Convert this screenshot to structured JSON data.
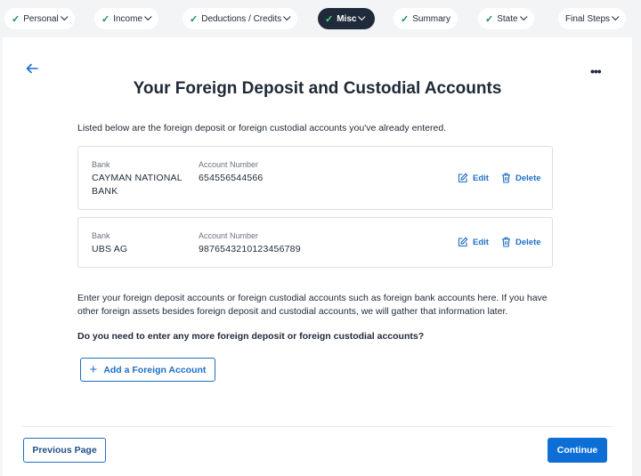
{
  "nav": {
    "tabs": [
      {
        "label": "Personal",
        "completed": true,
        "active": false
      },
      {
        "label": "Income",
        "completed": true,
        "active": false
      },
      {
        "label": "Deductions / Credits",
        "completed": true,
        "active": false
      },
      {
        "label": "Misc",
        "completed": true,
        "active": true
      },
      {
        "label": "Summary",
        "completed": true,
        "active": false
      },
      {
        "label": "State",
        "completed": true,
        "active": false
      },
      {
        "label": "Final Steps",
        "completed": false,
        "active": false
      }
    ]
  },
  "page": {
    "title": "Your Foreign Deposit and Custodial Accounts",
    "intro": "Listed below are the foreign deposit or foreign custodial accounts you've already entered.",
    "paragraph": "Enter your foreign deposit accounts or foreign custodial accounts such as foreign bank accounts here. If you have other foreign assets besides foreign deposit and custodial accounts, we will gather that information later.",
    "question": "Do you need to enter any more foreign deposit or foreign custodial accounts?"
  },
  "accounts": [
    {
      "bank_label": "Bank",
      "bank": "CAYMAN NATIONAL BANK",
      "number_label": "Account Number",
      "number": "654556544566",
      "edit_label": "Edit",
      "delete_label": "Delete"
    },
    {
      "bank_label": "Bank",
      "bank": "UBS AG",
      "number_label": "Account Number",
      "number": "9876543210123456789",
      "edit_label": "Edit",
      "delete_label": "Delete"
    }
  ],
  "buttons": {
    "add_account": "Add a Foreign Account",
    "previous": "Previous Page",
    "continue": "Continue"
  },
  "icons": {
    "back": "back-arrow-icon",
    "more": "more-options-icon",
    "check": "check-icon",
    "edit": "edit-icon",
    "delete": "trash-icon",
    "add": "plus-icon"
  },
  "colors": {
    "accent": "#0d6fd6",
    "link": "#1f6fc4",
    "active_tab": "#1f2a3a",
    "check": "#1a8a5c"
  }
}
